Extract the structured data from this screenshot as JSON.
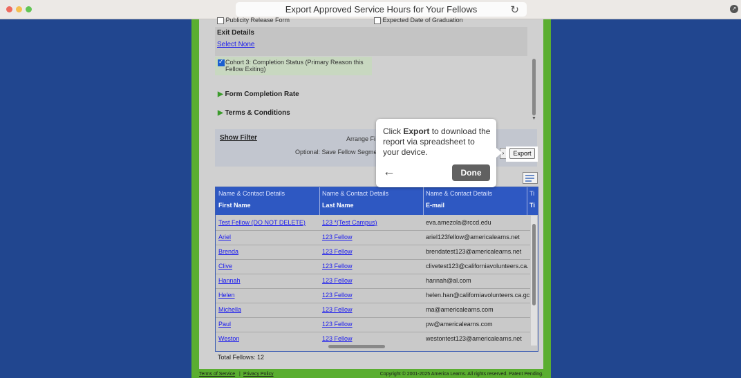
{
  "window": {
    "title": "Export Approved Service Hours for Your Fellows",
    "traffic_light_colors": [
      "#ed6a5e",
      "#f5bf4f",
      "#61c554"
    ]
  },
  "form": {
    "publicity_label": "Publicity Release Form",
    "expected_grad_label": "Expected Date of Graduation",
    "exit_details_heading": "Exit Details",
    "select_none_link": "Select None",
    "cohort_label": "Cohort 3: Completion Status (Primary Reason this Fellow Exiting)",
    "form_completion_rate": "Form Completion Rate",
    "terms_conditions": "Terms & Conditions"
  },
  "filter": {
    "show_filter": "Show Filter",
    "arrange_label": "Arrange Fi",
    "save_segment_label": "Optional: Save Fellow Segme",
    "export_button": "Export"
  },
  "popover": {
    "text_before": "Click ",
    "text_bold": "Export",
    "text_after": " to download the report via spreadsheet to your device.",
    "done_button": "Done"
  },
  "table": {
    "group_header": "Name & Contact Details",
    "group_header_trunc": "Ti",
    "columns": [
      "First Name",
      "Last Name",
      "E-mail",
      "Ti"
    ],
    "rows": [
      {
        "first": "Test Fellow (DO NOT DELETE)",
        "last": "123 *(Test Campus)",
        "email": "eva.amezola@rccd.edu"
      },
      {
        "first": "Ariel",
        "last": "123 Fellow",
        "email": "ariel123fellow@americalearns.net"
      },
      {
        "first": "Brenda",
        "last": "123 Fellow",
        "email": "brendatest123@americalearns.net"
      },
      {
        "first": "Clive",
        "last": "123 Fellow",
        "email": "clivetest123@californiavolunteers.ca."
      },
      {
        "first": "Hannah",
        "last": "123 Fellow",
        "email": "hannah@al.com"
      },
      {
        "first": "Helen",
        "last": "123 Fellow",
        "email": "helen.han@californiavolunteers.ca.gc"
      },
      {
        "first": "Michella",
        "last": "123 Fellow",
        "email": "ma@americalearns.com"
      },
      {
        "first": "Paul",
        "last": "123 Fellow",
        "email": "pw@americalearns.com"
      },
      {
        "first": "Weston",
        "last": "123 Fellow",
        "email": "westontest123@americalearns.net"
      }
    ],
    "total_fellows": "Total Fellows: 12"
  },
  "footer": {
    "terms": "Terms of Service",
    "privacy": "Privacy Policy",
    "copyright": "Copyright © 2001-2025 America Learns. All rights reserved. Patent Pending."
  }
}
